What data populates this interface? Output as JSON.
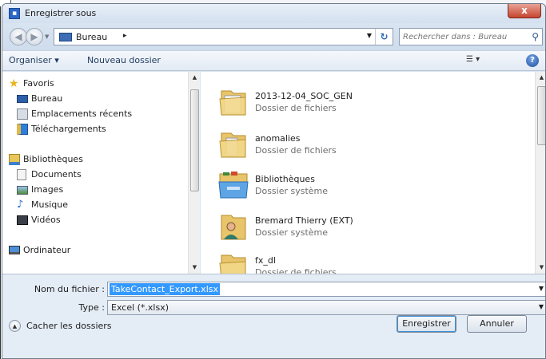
{
  "window": {
    "title": "Enregistrer sous",
    "close_glyph": "x"
  },
  "address_bar": {
    "breadcrumb": "Bureau",
    "crumb_arrow": "▸"
  },
  "search": {
    "placeholder": "Rechercher dans : Bureau"
  },
  "toolbar": {
    "organize_label": "Organiser ▾",
    "new_folder_label": "Nouveau dossier",
    "view_label": "☰ ▾",
    "help_glyph": "?"
  },
  "sidebar": {
    "favorites": {
      "label": "Favoris",
      "items": [
        "Bureau",
        "Emplacements récents",
        "Téléchargements"
      ]
    },
    "libraries": {
      "label": "Bibliothèques",
      "items": [
        "Documents",
        "Images",
        "Musique",
        "Vidéos"
      ]
    },
    "computer": {
      "label": "Ordinateur"
    }
  },
  "files": [
    {
      "name": "2013-12-04_SOC_GEN",
      "type": "Dossier de fichiers",
      "icon": "folder-icon"
    },
    {
      "name": "anomalies",
      "type": "Dossier de fichiers",
      "icon": "folder-icon"
    },
    {
      "name": "Bibliothèques",
      "type": "Dossier système",
      "icon": "libraries-icon"
    },
    {
      "name": "Bremard Thierry (EXT)",
      "type": "Dossier système",
      "icon": "user-folder-icon"
    },
    {
      "name": "fx_dl",
      "type": "Dossier de fichiers",
      "icon": "folder-icon"
    }
  ],
  "form": {
    "filename_label": "Nom du fichier :",
    "filename_value": "TakeContact_Export.xlsx",
    "type_label": "Type :",
    "type_value": "Excel (*.xlsx)"
  },
  "footer": {
    "hide_folders_label": "Cacher les dossiers",
    "save_label": "Enregistrer",
    "cancel_label": "Annuler"
  }
}
